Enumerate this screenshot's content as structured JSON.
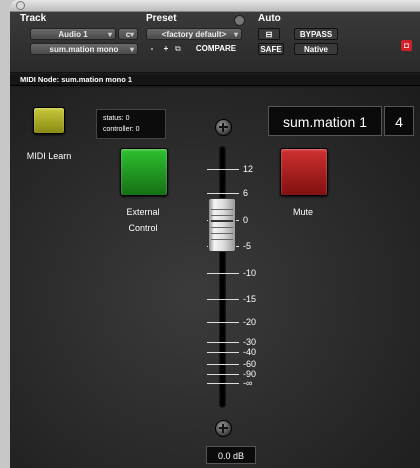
{
  "header": {
    "track_label": "Track",
    "preset_label": "Preset",
    "auto_label": "Auto",
    "track_name": "Audio 1",
    "channel": "c",
    "plugin": "sum.mation mono",
    "preset_value": "<factory default>",
    "minus": "-",
    "plus": "+",
    "compare": "COMPARE",
    "bypass": "BYPASS",
    "safe": "SAFE",
    "native": "Native"
  },
  "midi_node": "MIDI Node: sum.mation mono 1",
  "status": {
    "line1": "status: 0",
    "line2": "controller: 0"
  },
  "midi_learn": "MIDI Learn",
  "external_control_1": "External",
  "external_control_2": "Control",
  "mute": "Mute",
  "plugin_name": "sum.mation 1",
  "plugin_number": "4",
  "fader": {
    "value": "0.0 dB",
    "scale": [
      "12",
      "6",
      "0",
      "-5",
      "-10",
      "-15",
      "-20",
      "-30",
      "-40",
      "-60",
      "-90",
      "-∞"
    ]
  },
  "colors": {
    "midi_learn": "#a8a81e",
    "external_control": "#1c9a1c",
    "mute": "#b01c1c",
    "close_icon": "#d02028"
  }
}
